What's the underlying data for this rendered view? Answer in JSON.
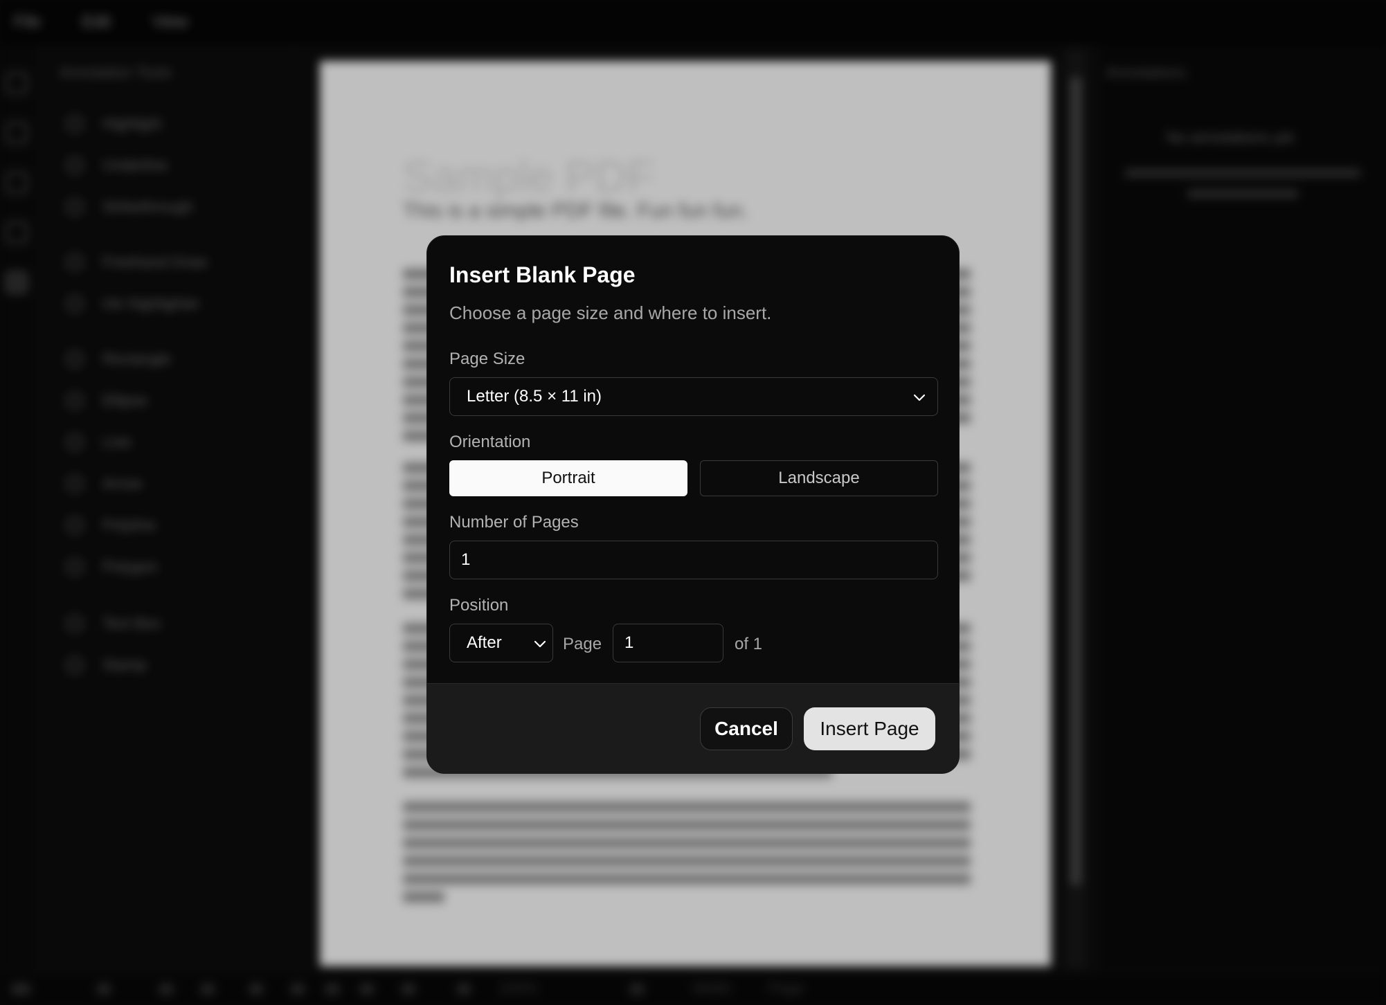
{
  "background": {
    "menu": [
      "File",
      "Edit",
      "View"
    ],
    "tools_title": "Annotation Tools",
    "tools": [
      "Highlight",
      "Underline",
      "Strikethrough",
      "Freehand Draw",
      "Ink Highlighter",
      "Rectangle",
      "Ellipse",
      "Line",
      "Arrow",
      "Polyline",
      "Polygon",
      "Text Box",
      "Stamp"
    ],
    "doc_title": "Sample PDF",
    "doc_subtitle": "This is a simple PDF file. Fun fun fun.",
    "annotations_title": "Annotations",
    "annotations_empty": "No annotations yet",
    "zoom": "100%",
    "fit_width": "Width",
    "fit_page": "Page"
  },
  "dialog": {
    "title": "Insert Blank Page",
    "description": "Choose a page size and where to insert.",
    "page_size_label": "Page Size",
    "page_size_value": "Letter (8.5 × 11 in)",
    "orientation_label": "Orientation",
    "orientation_portrait": "Portrait",
    "orientation_landscape": "Landscape",
    "orientation_selected": "Portrait",
    "num_pages_label": "Number of Pages",
    "num_pages_value": "1",
    "position_label": "Position",
    "position_value": "After",
    "page_word": "Page",
    "page_value": "1",
    "of_text": "of 1",
    "cancel_label": "Cancel",
    "insert_label": "Insert Page"
  },
  "colors": {
    "dialog_bg": "#0b0b0b",
    "footer_bg": "#1b1b1b",
    "selected_toggle": "#fafafa",
    "primary_button": "#e3e3e3"
  }
}
